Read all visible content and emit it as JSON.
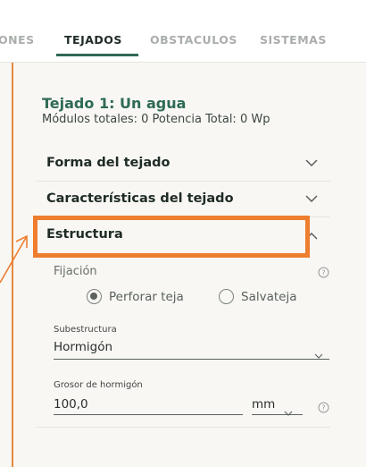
{
  "tabs": [
    {
      "label": "ONES",
      "active": false
    },
    {
      "label": "TEJADOS",
      "active": true
    },
    {
      "label": "OBSTACULOS",
      "active": false
    },
    {
      "label": "SISTEMAS",
      "active": false
    }
  ],
  "roof": {
    "title": "Tejado 1: Un agua",
    "summary": "Módulos totales: 0 Potencia Total: 0 Wp"
  },
  "sections": [
    {
      "label": "Forma del tejado",
      "expanded": false
    },
    {
      "label": "Características del tejado",
      "expanded": false
    },
    {
      "label": "Estructura",
      "expanded": true
    }
  ],
  "estructura": {
    "fijacion_label": "Fijación",
    "fijacion_options": [
      {
        "label": "Perforar teja",
        "selected": true
      },
      {
        "label": "Salvateja",
        "selected": false
      }
    ],
    "subestructura_label": "Subestructura",
    "subestructura_value": "Hormigón",
    "grosor_label": "Grosor de hormigón",
    "grosor_value": "100,0",
    "grosor_unit": "mm"
  },
  "colors": {
    "accent": "#2e6a55",
    "highlight": "#ee7d2e"
  },
  "icons": {
    "chevron_down": "chevron-down-icon",
    "chevron_up": "chevron-up-icon",
    "help": "help-icon"
  }
}
